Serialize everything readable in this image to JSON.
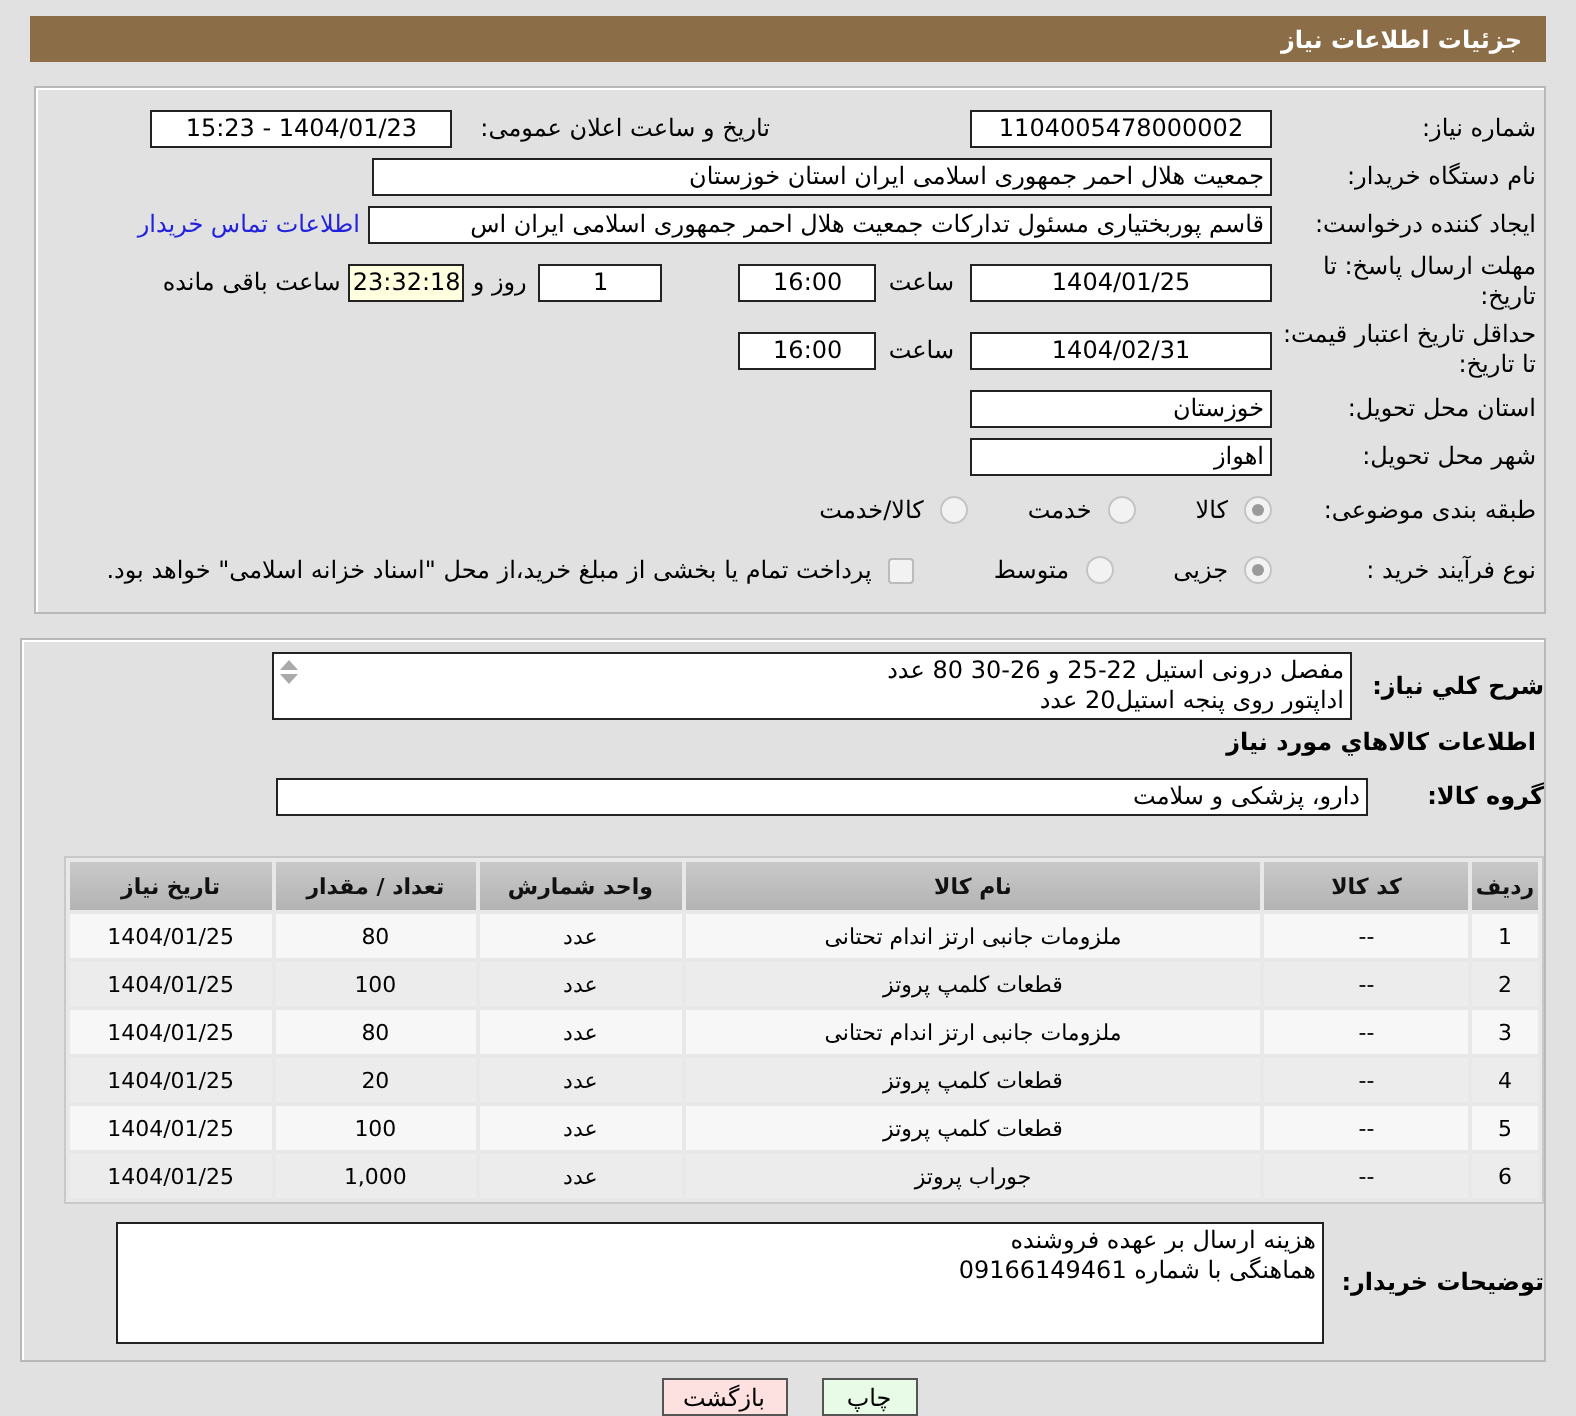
{
  "header": {
    "title": "جزئیات اطلاعات نیاز"
  },
  "need_number": {
    "label": "شماره نیاز:",
    "value": "1104005478000002"
  },
  "announce": {
    "label": "تاریخ و ساعت اعلان عمومی:",
    "value": "1404/01/23 - 15:23"
  },
  "buyer_org": {
    "label": "نام دستگاه خریدار:",
    "value": "جمعیت هلال احمر جمهوری اسلامی ایران استان خوزستان"
  },
  "requester": {
    "label": "ایجاد کننده درخواست:",
    "value": "قاسم پوربختیاری مسئول تدارکات جمعیت هلال احمر جمهوری اسلامی ایران اس",
    "link": "اطلاعات تماس خریدار"
  },
  "response_deadline": {
    "label": "مهلت ارسال پاسخ: تا تاریخ:",
    "date": "1404/01/25",
    "time_label": "ساعت",
    "time": "16:00",
    "days": "1",
    "days_label": "روز و",
    "remaining": "23:32:18",
    "remaining_label": "ساعت باقی مانده"
  },
  "price_validity": {
    "label": "حداقل تاریخ اعتبار قیمت: تا تاریخ:",
    "date": "1404/02/31",
    "time_label": "ساعت",
    "time": "16:00"
  },
  "province": {
    "label": "استان محل تحویل:",
    "value": "خوزستان"
  },
  "city": {
    "label": "شهر محل تحویل:",
    "value": "اهواز"
  },
  "category": {
    "label": "طبقه بندی موضوعی:",
    "options": [
      {
        "label": "کالا",
        "selected": true
      },
      {
        "label": "خدمت",
        "selected": false
      },
      {
        "label": "کالا/خدمت",
        "selected": false
      }
    ]
  },
  "process": {
    "label": "نوع فرآیند خرید :",
    "options": [
      {
        "label": "جزیی",
        "selected": true
      },
      {
        "label": "متوسط",
        "selected": false
      }
    ],
    "payment": {
      "label": "پرداخت تمام یا بخشی از مبلغ خرید،از محل \"اسناد خزانه اسلامی\" خواهد بود.",
      "checked": false
    }
  },
  "description": {
    "label": "شرح کلي نياز:",
    "lines": [
      "مفصل درونی استیل 22-25 و 26-30 80 عدد",
      "اداپتور روی پنجه استیل20 عدد"
    ]
  },
  "goods_heading": "اطلاعات کالاهاي مورد نياز",
  "goods_group": {
    "label": "گروه کالا:",
    "value": "دارو، پزشکی و سلامت"
  },
  "table": {
    "columns": [
      "ردیف",
      "کد کالا",
      "نام کالا",
      "واحد شمارش",
      "تعداد / مقدار",
      "تاریخ نیاز"
    ],
    "rows": [
      [
        "1",
        "--",
        "ملزومات جانبی ارتز اندام تحتانی",
        "عدد",
        "80",
        "1404/01/25"
      ],
      [
        "2",
        "--",
        "قطعات کلمپ پروتز",
        "عدد",
        "100",
        "1404/01/25"
      ],
      [
        "3",
        "--",
        "ملزومات جانبی ارتز اندام تحتانی",
        "عدد",
        "80",
        "1404/01/25"
      ],
      [
        "4",
        "--",
        "قطعات کلمپ پروتز",
        "عدد",
        "20",
        "1404/01/25"
      ],
      [
        "5",
        "--",
        "قطعات کلمپ پروتز",
        "عدد",
        "100",
        "1404/01/25"
      ],
      [
        "6",
        "--",
        "جوراب پروتز",
        "عدد",
        "1,000",
        "1404/01/25"
      ]
    ]
  },
  "buyer_notes": {
    "label": "توضیحات خریدار:",
    "lines": [
      "هزینه ارسال بر عهده فروشنده",
      "هماهنگی با شماره 09166149461"
    ]
  },
  "buttons": [
    {
      "label": "چاپ",
      "kind": "print"
    },
    {
      "label": "بازگشت",
      "kind": "back"
    }
  ]
}
